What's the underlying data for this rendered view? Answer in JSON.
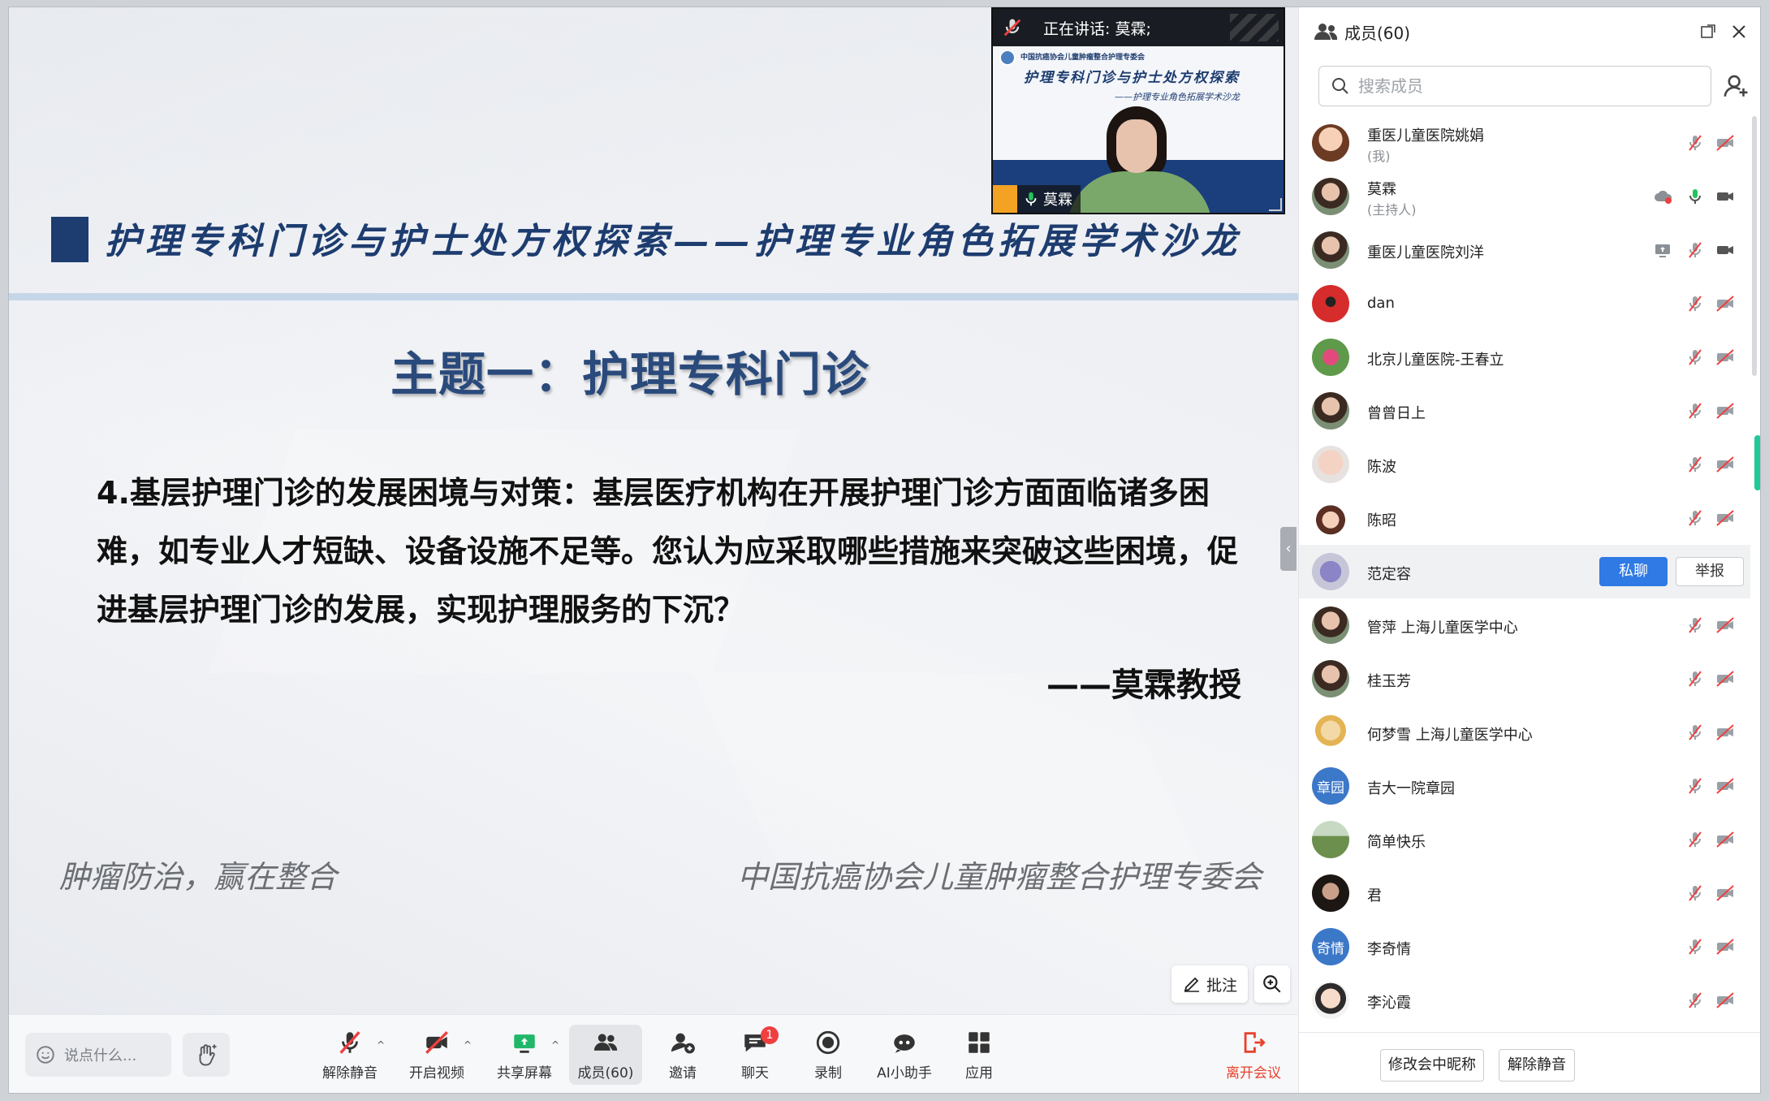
{
  "video": {
    "speaking_label": "正在讲话:  莫霖;",
    "name": "莫霖",
    "slide_org": "中国抗癌协会儿童肿瘤整合护理专委会",
    "slide_title": "护理专科门诊与护士处方权探索",
    "slide_subtitle": "——护理专业角色拓展学术沙龙"
  },
  "slide": {
    "title": "护理专科门诊与护士处方权探索——护理专业角色拓展学术沙龙",
    "topic": "主题一：护理专科门诊",
    "question": "4.基层护理门诊的发展困境与对策：基层医疗机构在开展护理门诊方面面临诸多困难，如专业人才短缺、设备设施不足等。您认为应采取哪些措施来突破这些困境，促进基层护理门诊的发展，实现护理服务的下沉？",
    "author": "——莫霖教授",
    "footer_left": "肿瘤防治，赢在整合",
    "footer_right": "中国抗癌协会儿童肿瘤整合护理专委会"
  },
  "controls": {
    "annotate_label": "批注",
    "chat_placeholder": "说点什么..."
  },
  "toolbar": {
    "unmute": "解除静音",
    "start_video": "开启视频",
    "share_screen": "共享屏幕",
    "members": "成员(60)",
    "invite": "邀请",
    "chat": "聊天",
    "chat_badge": "1",
    "record": "录制",
    "ai_assistant": "AI小助手",
    "apps": "应用",
    "leave": "离开会议"
  },
  "panel": {
    "title": "成员(60)",
    "search_placeholder": "搜索成员",
    "members": [
      {
        "name": "重医儿童医院姚娟",
        "role": "(我)",
        "avatar": "cartoon"
      },
      {
        "name": "莫霖",
        "role": "(主持人)",
        "avatar": "photo"
      },
      {
        "name": "重医儿童医院刘洋",
        "role": "",
        "avatar": "photo"
      },
      {
        "name": "dan",
        "role": "",
        "avatar": "red"
      },
      {
        "name": "北京儿童医院-王春立",
        "role": "",
        "avatar": "flower"
      },
      {
        "name": "曾曾日上",
        "role": "",
        "avatar": "photo"
      },
      {
        "name": "陈波",
        "role": "",
        "avatar": "baby"
      },
      {
        "name": "陈昭",
        "role": "",
        "avatar": "girl"
      },
      {
        "name": "范定容",
        "role": "",
        "avatar": "flower2"
      },
      {
        "name": "管萍 上海儿童医学中心",
        "role": "",
        "avatar": "photo"
      },
      {
        "name": "桂玉芳",
        "role": "",
        "avatar": "photo"
      },
      {
        "name": "何梦雪 上海儿童医学中心",
        "role": "",
        "avatar": "cartoon2"
      },
      {
        "name": "吉大一院章园",
        "role": "",
        "avatar_text": "章园"
      },
      {
        "name": "简单快乐",
        "role": "",
        "avatar": "landscape"
      },
      {
        "name": "君",
        "role": "",
        "avatar": "dark"
      },
      {
        "name": "李奇情",
        "role": "",
        "avatar_text": "奇情"
      },
      {
        "name": "李沁霞",
        "role": "",
        "avatar": "cartoon3"
      }
    ],
    "private_chat": "私聊",
    "report": "举报",
    "rename": "修改会中昵称",
    "unmute_all": "解除静音"
  },
  "colors": {
    "accent": "#2f7ae5",
    "slide_navy": "#1d3c6f",
    "leave_red": "#e8412c",
    "badge_red": "#ef3f3f"
  }
}
